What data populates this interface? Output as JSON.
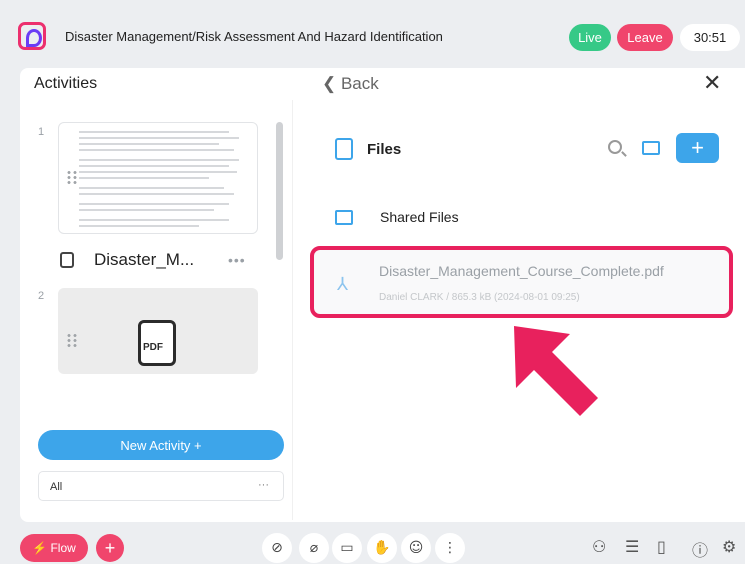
{
  "header": {
    "title": "Disaster Management/Risk Assessment And Hazard Identification",
    "live_label": "Live",
    "leave_label": "Leave",
    "timer": "30:51"
  },
  "activities": {
    "title": "Activities",
    "items": [
      {
        "number": "1",
        "label": "Disaster_M...",
        "more": "•••"
      },
      {
        "number": "2",
        "thumb_label": "PDF"
      }
    ],
    "new_activity_label": "New Activity +",
    "filter_value": "All",
    "filter_more": "···"
  },
  "files": {
    "back_label": "Back",
    "close_label": "✕",
    "heading": "Files",
    "add_label": "+",
    "shared_label": "Shared Files",
    "file": {
      "name": "Disaster_Management_Course_Complete.pdf",
      "meta": "Daniel CLARK / 865.3 kB (2024-08-01 09:25)"
    }
  },
  "bottom": {
    "flow_label": "⚡ Flow",
    "plus_label": "+"
  },
  "colors": {
    "accent_blue": "#3da5ea",
    "live_green": "#36c987",
    "leave_pink": "#f0456c",
    "highlight": "#e8215d"
  }
}
